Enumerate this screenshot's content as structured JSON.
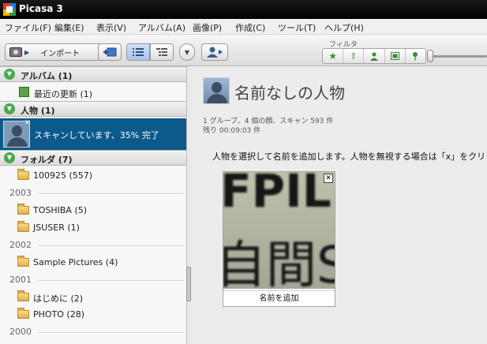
{
  "window": {
    "title": "Picasa 3"
  },
  "menu": {
    "items": [
      "ファイル(F)",
      "編集(E)",
      "表示(V)",
      "アルバム(A)",
      "画像(P)",
      "作成(C)",
      "ツール(T)",
      "ヘルプ(H)"
    ]
  },
  "toolbar": {
    "import_label": "インポート",
    "filter_label": "フィルタ",
    "filter_icons": [
      "star-icon",
      "upload-icon",
      "person-icon",
      "film-icon",
      "pin-icon"
    ]
  },
  "sidebar": {
    "albums_header": "アルバム (1)",
    "recent_label": "最近の更新 (1)",
    "people_header": "人物 (1)",
    "scanning_label": "スキャンしています、35% 完了",
    "scan_progress": 0.35,
    "folders_header": "フォルダ (7)",
    "folder_first": "100925 (557)",
    "years": [
      "2003",
      "2002",
      "2001",
      "2000"
    ],
    "folders_2003": [
      "TOSHIBA (5)",
      "JSUSER (1)"
    ],
    "folders_2002": [
      "Sample Pictures (4)"
    ],
    "folders_2001": [
      "はじめに (2)",
      "PHOTO (28)"
    ]
  },
  "main": {
    "title": "名前なしの人物",
    "stats": "1 グループ、4 個の顔、スキャン 593 件",
    "remaining": "残り 00:09:03 件",
    "instruction": "人物を選択して名前を追加します。人物を無視する場合は「x」をクリックしま",
    "face_glyphs_top": "FPIL.",
    "face_glyphs_bottom": "自間S",
    "add_name_label": "名前を追加"
  },
  "colors": {
    "selected_row": "#0c5a8c",
    "section_triangle": "#4ea84e"
  }
}
